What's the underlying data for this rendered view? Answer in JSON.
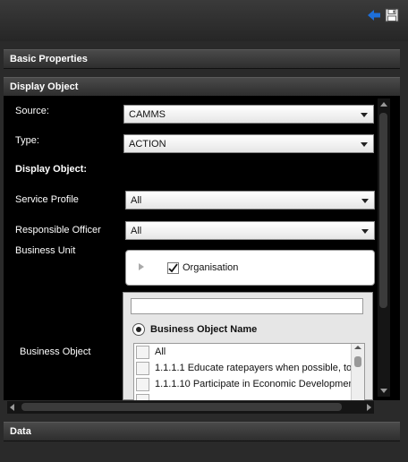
{
  "sections": {
    "basic_properties": "Basic Properties",
    "display_object": "Display Object",
    "data": "Data"
  },
  "form": {
    "source_label": "Source:",
    "source_value": "CAMMS",
    "type_label": "Type:",
    "type_value": "ACTION",
    "display_object_label": "Display Object:",
    "service_profile_label": "Service Profile",
    "service_profile_value": "All",
    "responsible_officer_label": "Responsible Officer",
    "responsible_officer_value": "All",
    "business_unit_label": "Business Unit",
    "business_unit_tree": {
      "label": "Organisation",
      "checked": true
    },
    "business_object_label": "Business Object",
    "business_object_search": "",
    "business_object_radio": "Business Object Name",
    "business_object_items": [
      "All",
      "1.1.1.1 Educate ratepayers when possible, to",
      "1.1.1.10 Participate in Economic Development"
    ]
  },
  "icons": {
    "back": "back-arrow-icon",
    "save": "save-icon"
  },
  "colors": {
    "accent_arrow": "#1e6fd9",
    "panel_bg": "#000000",
    "header_bg": "#3a3a3a"
  }
}
